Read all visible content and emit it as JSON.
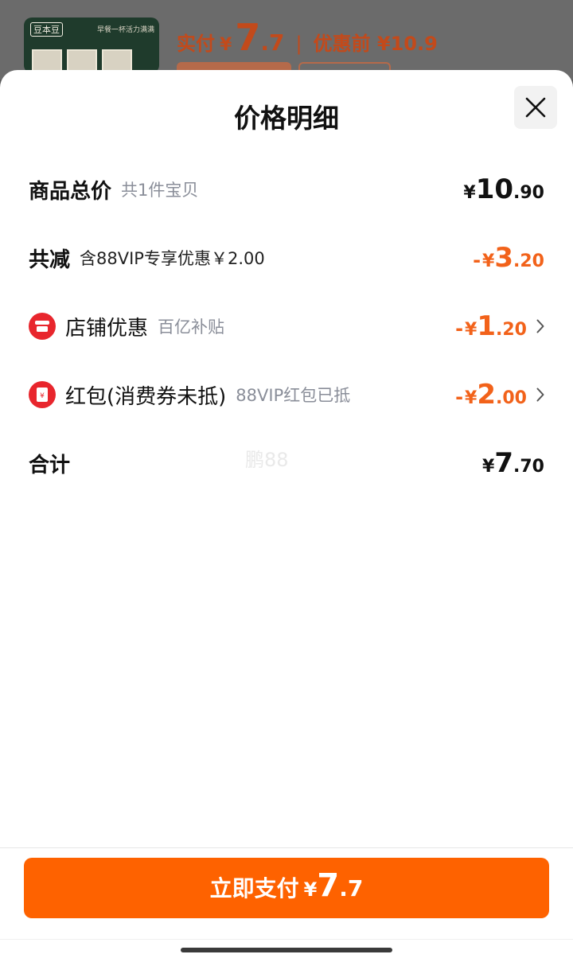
{
  "background": {
    "product": {
      "brand": "豆本豆",
      "slogan": "早餐一杯活力满满"
    },
    "price_line": {
      "label": "实付",
      "yen": "¥",
      "price_int": "7",
      "price_dec": ".7",
      "separator": "|",
      "original": "优惠前 ¥10.9"
    }
  },
  "sheet": {
    "title": "价格明细",
    "rows": [
      {
        "label": "商品总价",
        "sub": "共1件宝贝",
        "amount": {
          "prefix": "",
          "yen": "¥",
          "int": "10",
          "dec": ".90"
        }
      },
      {
        "label": "共减",
        "sub": "含88VIP专享优惠￥2.00",
        "amount": {
          "prefix": "-",
          "yen": "¥",
          "int": "3",
          "dec": ".20"
        }
      },
      {
        "label": "店铺优惠",
        "sub": "百亿补贴",
        "icon": "shop-icon",
        "amount": {
          "prefix": "-",
          "yen": "¥",
          "int": "1",
          "dec": ".20"
        }
      },
      {
        "label": "红包(消费券未抵)",
        "sub": "88VIP红包已抵",
        "icon": "red-packet-icon",
        "amount": {
          "prefix": "-",
          "yen": "¥",
          "int": "2",
          "dec": ".00"
        }
      },
      {
        "label": "合计",
        "sub": "",
        "amount": {
          "prefix": "",
          "yen": "¥",
          "int": "7",
          "dec": ".70"
        }
      }
    ],
    "watermark": "鹏88"
  },
  "pay_button": {
    "label": "立即支付",
    "yen": "¥",
    "int": "7",
    "dec": ".7"
  },
  "colors": {
    "accent": "#fe6200",
    "discount": "#f2621a",
    "icon_red": "#e8262d"
  }
}
